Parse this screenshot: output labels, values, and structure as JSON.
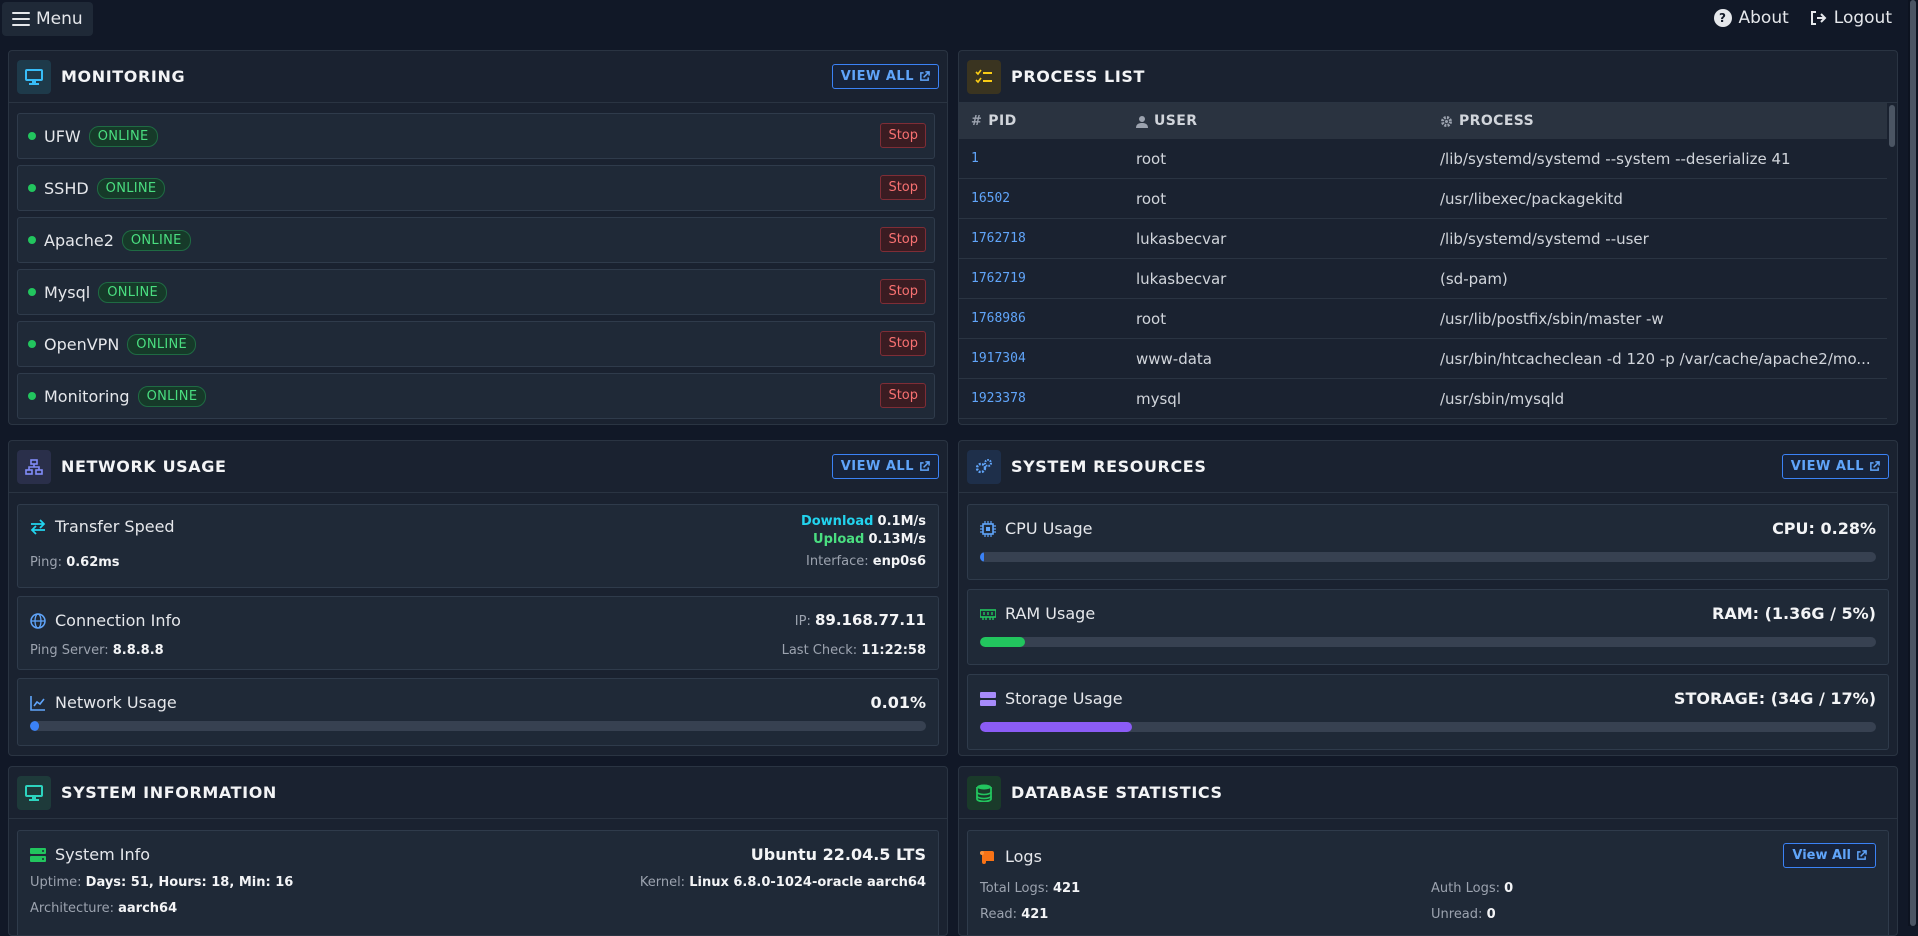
{
  "topbar": {
    "menu_label": "Menu",
    "about_label": "About",
    "logout_label": "Logout"
  },
  "monitoring": {
    "title": "MONITORING",
    "view_all": "VIEW ALL",
    "services": [
      {
        "name": "UFW",
        "status": "ONLINE",
        "action": "Stop"
      },
      {
        "name": "SSHD",
        "status": "ONLINE",
        "action": "Stop"
      },
      {
        "name": "Apache2",
        "status": "ONLINE",
        "action": "Stop"
      },
      {
        "name": "Mysql",
        "status": "ONLINE",
        "action": "Stop"
      },
      {
        "name": "OpenVPN",
        "status": "ONLINE",
        "action": "Stop"
      },
      {
        "name": "Monitoring",
        "status": "ONLINE",
        "action": "Stop"
      }
    ]
  },
  "process_list": {
    "title": "PROCESS LIST",
    "columns": [
      "PID",
      "USER",
      "PROCESS"
    ],
    "rows": [
      {
        "pid": "1",
        "user": "root",
        "process": "/lib/systemd/systemd --system --deserialize 41"
      },
      {
        "pid": "16502",
        "user": "root",
        "process": "/usr/libexec/packagekitd"
      },
      {
        "pid": "1762718",
        "user": "lukasbecvar",
        "process": "/lib/systemd/systemd --user"
      },
      {
        "pid": "1762719",
        "user": "lukasbecvar",
        "process": "(sd-pam)"
      },
      {
        "pid": "1768986",
        "user": "root",
        "process": "/usr/lib/postfix/sbin/master -w"
      },
      {
        "pid": "1917304",
        "user": "www-data",
        "process": "/usr/bin/htcacheclean -d 120 -p /var/cache/apache2/mo..."
      },
      {
        "pid": "1923378",
        "user": "mysql",
        "process": "/usr/sbin/mysqld"
      }
    ]
  },
  "network": {
    "title": "NETWORK USAGE",
    "view_all": "VIEW ALL",
    "transfer_title": "Transfer Speed",
    "ping_label": "Ping:",
    "ping_value": "0.62ms",
    "download_label": "Download",
    "download_value": "0.1M/s",
    "upload_label": "Upload",
    "upload_value": "0.13M/s",
    "interface_label": "Interface:",
    "interface_value": "enp0s6",
    "conn_title": "Connection Info",
    "ping_server_label": "Ping Server:",
    "ping_server_value": "8.8.8.8",
    "ip_label": "IP:",
    "ip_value": "89.168.77.11",
    "last_check_label": "Last Check:",
    "last_check_value": "11:22:58",
    "usage_title": "Network Usage",
    "usage_value": "0.01%",
    "usage_fraction": 0.01
  },
  "resources": {
    "title": "SYSTEM RESOURCES",
    "view_all": "VIEW ALL",
    "cpu_title": "CPU Usage",
    "cpu_value": "CPU: 0.28%",
    "cpu_fraction": 0.0028,
    "ram_title": "RAM Usage",
    "ram_value": "RAM: (1.36G / 5%)",
    "ram_fraction": 0.05,
    "storage_title": "Storage Usage",
    "storage_value": "STORAGE: (34G / 17%)",
    "storage_fraction": 0.17,
    "colors": {
      "cpu": "#3b82f6",
      "ram": "#22c55e",
      "storage": "#8b5cf6"
    }
  },
  "sysinfo": {
    "title": "SYSTEM INFORMATION",
    "panel_title": "System Info",
    "os": "Ubuntu 22.04.5 LTS",
    "uptime_label": "Uptime:",
    "uptime_value": "Days: 51, Hours: 18, Min: 16",
    "kernel_label": "Kernel:",
    "kernel_value": "Linux 6.8.0-1024-oracle aarch64",
    "arch_label": "Architecture:",
    "arch_value": "aarch64"
  },
  "database": {
    "title": "DATABASE STATISTICS",
    "logs_title": "Logs",
    "view_all": "View All",
    "total_logs_label": "Total Logs:",
    "total_logs_value": "421",
    "auth_logs_label": "Auth Logs:",
    "auth_logs_value": "0",
    "read_label": "Read:",
    "read_value": "421",
    "unread_label": "Unread:",
    "unread_value": "0"
  }
}
